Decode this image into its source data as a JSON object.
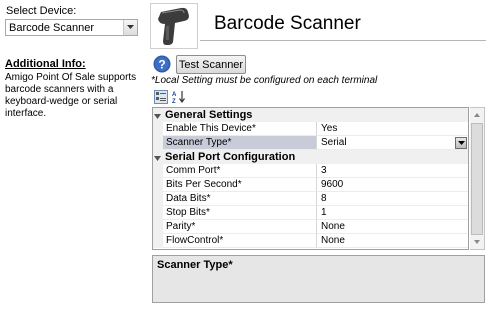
{
  "left_panel": {
    "device_label": "Select Device:",
    "device_value": "Barcode Scanner",
    "info_title": "Additional Info:",
    "info_text": "Amigo Point Of Sale supports barcode scanners with a keyboard-wedge or serial interface."
  },
  "header": {
    "title": "Barcode Scanner",
    "product_image": "barcode-scanner-image",
    "help_icon": "help-question-icon",
    "test_button": "Test Scanner",
    "note": "*Local Setting must be configured on each terminal"
  },
  "toolbar": {
    "categorized_icon": "categorized-view-icon",
    "alphabetical_icon": "sort-alphabetical-icon"
  },
  "grid": {
    "categories": [
      {
        "label": "General Settings",
        "properties": [
          {
            "name": "Enable This Device*",
            "value": "Yes"
          },
          {
            "name": "Scanner Type*",
            "value": "Serial"
          }
        ]
      },
      {
        "label": "Serial Port Configuration",
        "properties": [
          {
            "name": "Comm Port*",
            "value": "3"
          },
          {
            "name": "Bits Per Second*",
            "value": "9600"
          },
          {
            "name": "Data Bits*",
            "value": "8"
          },
          {
            "name": "Stop Bits*",
            "value": "1"
          },
          {
            "name": "Parity*",
            "value": "None"
          },
          {
            "name": "FlowControl*",
            "value": "None"
          }
        ]
      }
    ],
    "selected_property": "Scanner Type*"
  },
  "description": {
    "title": "Scanner Type*"
  },
  "colors": {
    "selected_row": "#c8ccd8",
    "category_bg": "#f0f0f0",
    "description_bg": "#e6e6e6",
    "help_icon_blue": "#2f5aa8"
  }
}
